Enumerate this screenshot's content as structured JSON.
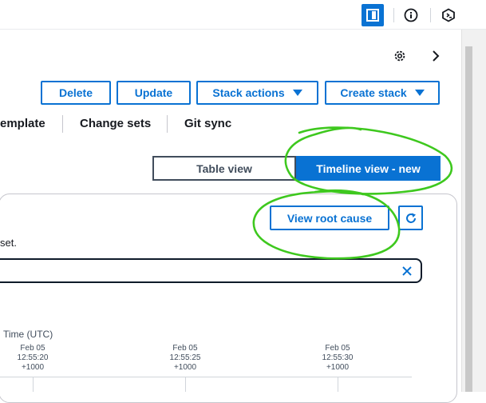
{
  "topbar": {
    "icons": [
      "panel-icon",
      "info-icon",
      "cloudshell-icon"
    ]
  },
  "header": {
    "icons": [
      "settings-icon",
      "chevron-right-icon"
    ]
  },
  "actions": {
    "delete_label": "Delete",
    "update_label": "Update",
    "stack_actions_label": "Stack actions",
    "create_stack_label": "Create stack"
  },
  "tabs": [
    {
      "label": "emplate"
    },
    {
      "label": "Change sets"
    },
    {
      "label": "Git sync"
    }
  ],
  "view_toggle": {
    "table_label": "Table view",
    "timeline_label": "Timeline view - new",
    "selected": "timeline"
  },
  "card": {
    "root_cause_label": "View root cause",
    "helper_text": "set.",
    "time_label": "Time (UTC)",
    "ticks": [
      {
        "date": "Feb 05",
        "time": "12:55:20",
        "tz": "+1000"
      },
      {
        "date": "Feb 05",
        "time": "12:55:25",
        "tz": "+1000"
      },
      {
        "date": "Feb 05",
        "time": "12:55:30",
        "tz": "+1000"
      }
    ]
  },
  "colors": {
    "accent": "#0972d3",
    "annotation": "#3ec81e",
    "text": "#16191f"
  }
}
